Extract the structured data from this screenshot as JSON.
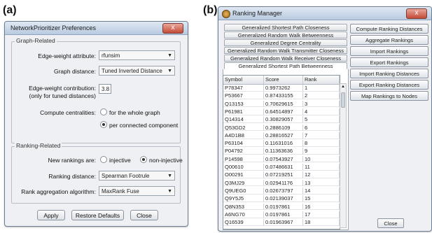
{
  "labels": {
    "a": "(a)",
    "b": "(b)"
  },
  "prefs": {
    "title": "NetworkPrioritizer Preferences",
    "close_glyph": "x",
    "graph_group": "Graph-Related",
    "edge_weight_attr_label": "Edge-weight attribute:",
    "edge_weight_attr_value": "rfunsim",
    "graph_distance_label": "Graph distance:",
    "graph_distance_value": "Tuned Inverted Distance",
    "edge_contrib_label": "Edge-weight contribution:",
    "edge_contrib_note": "(only for tuned distances)",
    "edge_contrib_value": "3.8",
    "centralities_label": "Compute centralities:",
    "centralities_opt1": "for the whole graph",
    "centralities_opt2": "per connected component",
    "ranking_group": "Ranking-Related",
    "new_rankings_label": "New rankings are:",
    "new_rankings_opt1": "injective",
    "new_rankings_opt2": "non-injective",
    "ranking_distance_label": "Ranking distance:",
    "ranking_distance_value": "Spearman Footrule",
    "rank_agg_label": "Rank aggregation algorithm:",
    "rank_agg_value": "MaxRank Fuse",
    "apply": "Apply",
    "restore": "Restore Defaults",
    "close": "Close"
  },
  "manager": {
    "title": "Ranking Manager",
    "close_glyph": "x",
    "tabs": [
      "Generalized Shortest Path Closeness",
      "Generalized Random Walk Betweenness",
      "Generalized Degree Centrality",
      "Generalized Random Walk Transmitter Closeness",
      "Generalized Random Walk Receiver Closeness",
      "Generalized Shortest Path Betweenness"
    ],
    "columns": [
      "Symbol",
      "Score",
      "Rank"
    ],
    "rows": [
      [
        "P78347",
        "0.9973262",
        "1"
      ],
      [
        "P53667",
        "0.87433155",
        "2"
      ],
      [
        "Q13153",
        "0.70629615",
        "3"
      ],
      [
        "P61981",
        "0.64514897",
        "4"
      ],
      [
        "Q14314",
        "0.30829057",
        "5"
      ],
      [
        "Q53GD2",
        "0.2886109",
        "6"
      ],
      [
        "A4D1B8",
        "0.28816527",
        "7"
      ],
      [
        "P63104",
        "0.11631016",
        "8"
      ],
      [
        "P04792",
        "0.11363636",
        "9"
      ],
      [
        "P14598",
        "0.07543927",
        "10"
      ],
      [
        "Q00610",
        "0.07486631",
        "11"
      ],
      [
        "O00291",
        "0.07219251",
        "12"
      ],
      [
        "Q3MJ29",
        "0.02941176",
        "13"
      ],
      [
        "Q9UEG0",
        "0.02673797",
        "14"
      ],
      [
        "Q9Y5J5",
        "0.02139037",
        "15"
      ],
      [
        "Q8N353",
        "0.0197861",
        "16"
      ],
      [
        "A6NG70",
        "0.0197861",
        "17"
      ],
      [
        "Q16539",
        "0.01963967",
        "18"
      ]
    ],
    "actions": [
      "Compute Ranking Distances",
      "Aggregate Rankings",
      "Import Rankings",
      "Export Rankings",
      "Import Ranking Distances",
      "Export Ranking Distances",
      "Map Rankings to Nodes"
    ],
    "close": "Close"
  }
}
